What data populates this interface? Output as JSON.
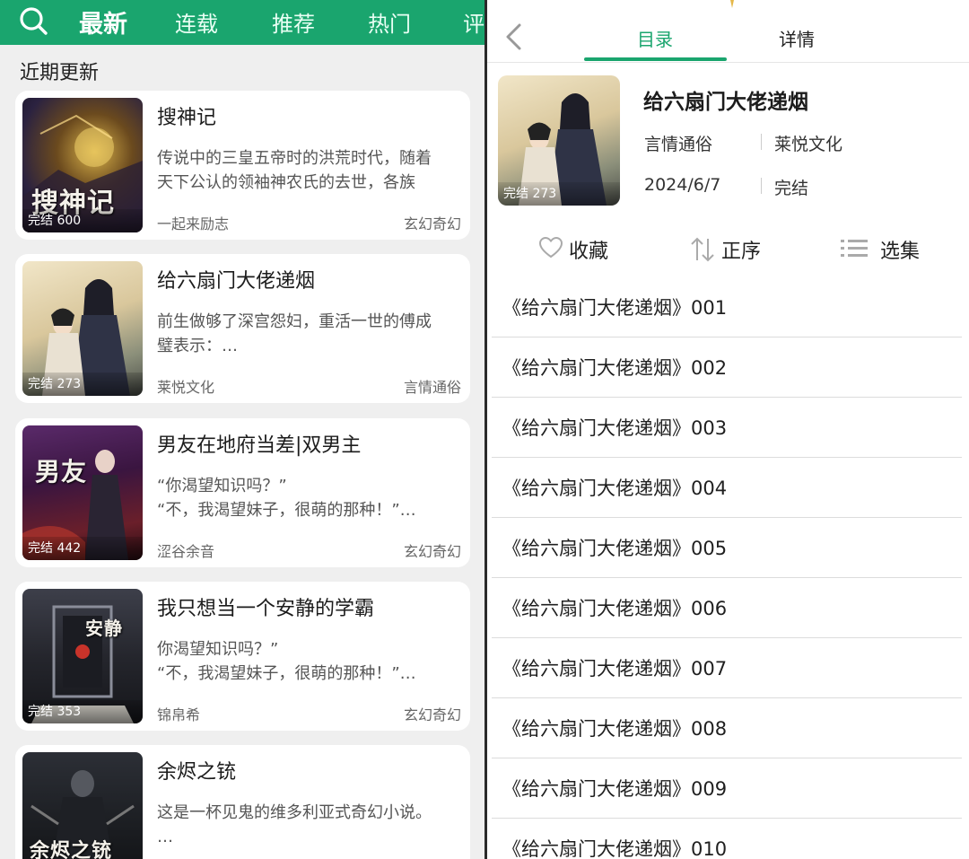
{
  "nav": {
    "tabs": [
      "最新",
      "连载",
      "推荐",
      "热门",
      "评"
    ],
    "active_tab": "最新"
  },
  "recent": {
    "section_title": "近期更新",
    "books": [
      {
        "title": "搜神记",
        "desc_lines": [
          "传说中的三皇五帝时的洪荒时代，随着",
          "天下公认的领袖神农氏的去世，各族"
        ],
        "author": "一起来励志",
        "genre": "玄幻奇幻",
        "cover_tag": "完结 600",
        "cover_title": "搜神记"
      },
      {
        "title": "给六扇门大佬递烟",
        "desc_lines": [
          "前生做够了深宫怨妇，重活一世的傅成",
          "璧表示：…"
        ],
        "author": "莱悦文化",
        "genre": "言情通俗",
        "cover_tag": "完结 273",
        "cover_title": ""
      },
      {
        "title": "男友在地府当差|双男主",
        "desc_lines": [
          "“你渴望知识吗？”",
          "“不，我渴望妹子，很萌的那种！”…"
        ],
        "author": "涩谷余音",
        "genre": "玄幻奇幻",
        "cover_tag": "完结 442",
        "cover_title": "男友"
      },
      {
        "title": "我只想当一个安静的学霸",
        "desc_lines": [
          "你渴望知识吗？”",
          "“不，我渴望妹子，很萌的那种！”…"
        ],
        "author": "锦帛希",
        "genre": "玄幻奇幻",
        "cover_tag": "完结 353",
        "cover_title": "安静"
      },
      {
        "title": "余烬之铳",
        "desc_lines": [
          "这是一杯见鬼的维多利亚式奇幻小说。",
          "…"
        ],
        "author": "",
        "genre": "",
        "cover_tag": "",
        "cover_title": "余烬之铳"
      }
    ]
  },
  "detail": {
    "tabs": [
      "目录",
      "详情"
    ],
    "active_tab": "目录",
    "title": "给六扇门大佬递烟",
    "category": "言情通俗",
    "publisher": "莱悦文化",
    "date": "2024/6/7",
    "status": "完结",
    "cover_tag": "完结 273",
    "actions": {
      "favorite": "收藏",
      "sort": "正序",
      "select": "选集"
    },
    "chapters": [
      "《给六扇门大佬递烟》001",
      "《给六扇门大佬递烟》002",
      "《给六扇门大佬递烟》003",
      "《给六扇门大佬递烟》004",
      "《给六扇门大佬递烟》005",
      "《给六扇门大佬递烟》006",
      "《给六扇门大佬递烟》007",
      "《给六扇门大佬递烟》008",
      "《给六扇门大佬递烟》009",
      "《给六扇门大佬递烟》010"
    ]
  },
  "colors": {
    "brand": "#1aa56e",
    "background": "#efefef"
  }
}
